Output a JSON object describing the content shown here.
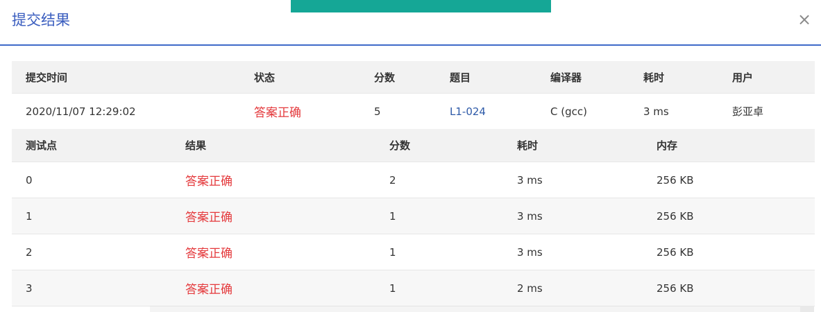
{
  "modal": {
    "title": "提交结果",
    "close_label": "×",
    "toast_color": "#15a796",
    "accent_color": "#3e69c9"
  },
  "summary": {
    "headers": [
      "提交时间",
      "状态",
      "分数",
      "题目",
      "编译器",
      "耗时",
      "用户"
    ],
    "row": {
      "time": "2020/11/07 12:29:02",
      "status": "答案正确",
      "score": "5",
      "problem": "L1-024",
      "compiler": "C (gcc)",
      "duration": "3 ms",
      "user": "彭亚卓"
    }
  },
  "cases": {
    "headers": [
      "测试点",
      "结果",
      "分数",
      "耗时",
      "内存"
    ],
    "rows": [
      {
        "id": "0",
        "result": "答案正确",
        "score": "2",
        "time": "3 ms",
        "memory": "256 KB"
      },
      {
        "id": "1",
        "result": "答案正确",
        "score": "1",
        "time": "3 ms",
        "memory": "256 KB"
      },
      {
        "id": "2",
        "result": "答案正确",
        "score": "1",
        "time": "3 ms",
        "memory": "256 KB"
      },
      {
        "id": "3",
        "result": "答案正确",
        "score": "1",
        "time": "2 ms",
        "memory": "256 KB"
      }
    ]
  }
}
